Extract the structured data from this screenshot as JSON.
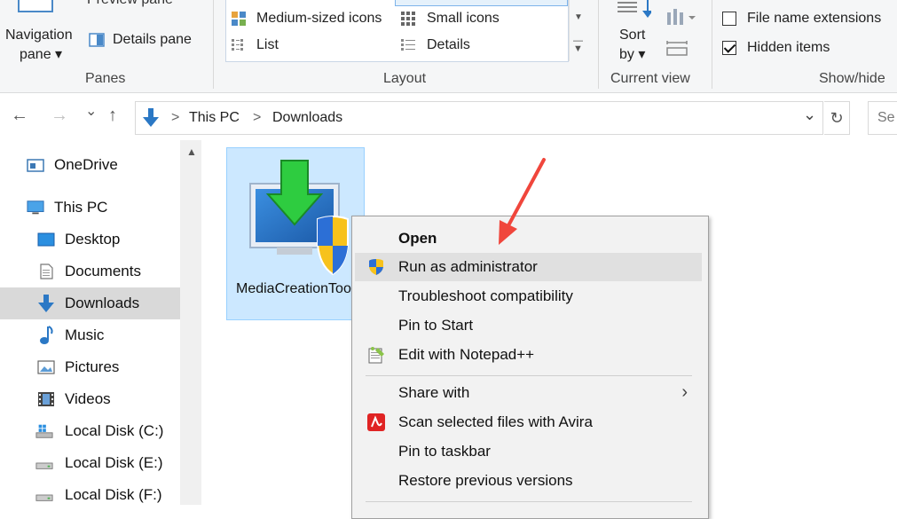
{
  "ribbon": {
    "panes": {
      "preview_pane": "Preview pane",
      "navigation_pane_line1": "Navigation",
      "navigation_pane_line2": "pane ▾",
      "details_pane": "Details pane",
      "group_label": "Panes"
    },
    "layout": {
      "medium_icons": "Medium-sized icons",
      "small_icons": "Small icons",
      "list": "List",
      "details": "Details",
      "group_label": "Layout"
    },
    "current_view": {
      "sort_line1": "Sort",
      "sort_line2": "by ▾",
      "group_label": "Current view"
    },
    "show_hide": {
      "file_name_extensions": "File name extensions",
      "file_name_extensions_checked": false,
      "hidden_items": "Hidden items",
      "hidden_items_checked": true,
      "group_label": "Show/hide"
    }
  },
  "address": {
    "back": "←",
    "forward": "→",
    "recent": "⌄",
    "up": "↑",
    "crumb_this_pc": "This PC",
    "crumb_sep": ">",
    "crumb_downloads": "Downloads",
    "dropdown": "⌄",
    "refresh": "↻",
    "search_placeholder": "Se"
  },
  "nav_pane": {
    "items": [
      {
        "label": "OneDrive"
      },
      {
        "label": "This PC"
      },
      {
        "label": "Desktop"
      },
      {
        "label": "Documents"
      },
      {
        "label": "Downloads"
      },
      {
        "label": "Music"
      },
      {
        "label": "Pictures"
      },
      {
        "label": "Videos"
      },
      {
        "label": "Local Disk (C:)"
      },
      {
        "label": "Local Disk (E:)"
      },
      {
        "label": "Local Disk (F:)"
      }
    ]
  },
  "content": {
    "file_name": "MediaCreationTool"
  },
  "context_menu": {
    "items": [
      {
        "label": "Open"
      },
      {
        "label": "Run as administrator"
      },
      {
        "label": "Troubleshoot compatibility"
      },
      {
        "label": "Pin to Start"
      },
      {
        "label": "Edit with Notepad++"
      },
      {
        "label": "Share with"
      },
      {
        "label": "Scan selected files with Avira"
      },
      {
        "label": "Pin to taskbar"
      },
      {
        "label": "Restore previous versions"
      }
    ]
  },
  "colors": {
    "accent": "#0078d7",
    "selection": "#cce8ff",
    "annotation_arrow": "#f0463c"
  }
}
